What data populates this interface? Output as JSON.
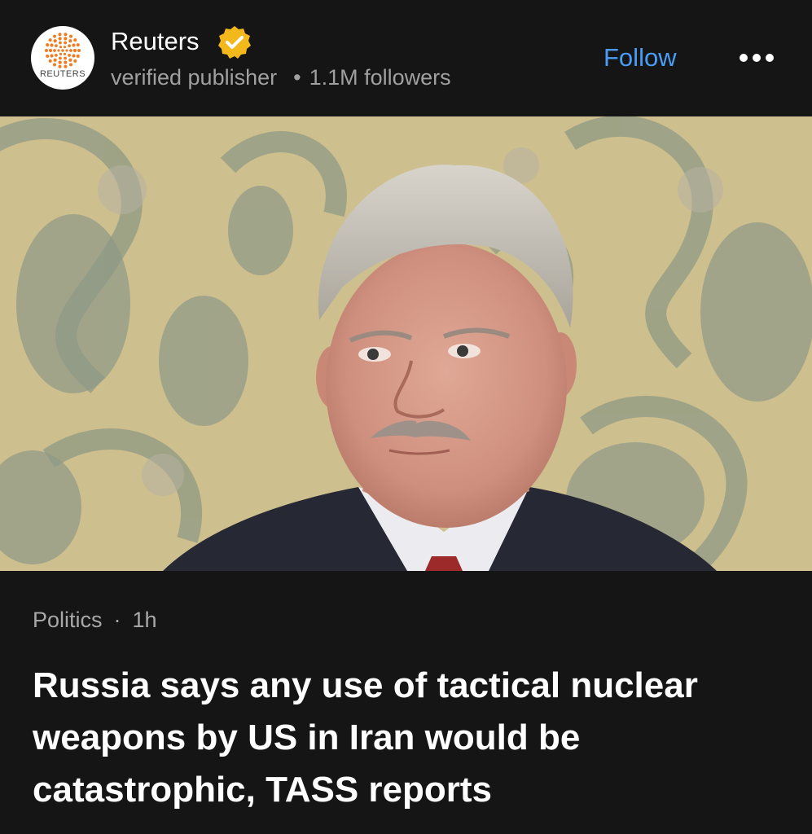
{
  "publisher": {
    "name": "Reuters",
    "logo_text": "REUTERS",
    "verified_icon": "verified-badge-icon",
    "subtitle": "verified publisher",
    "separator": "•",
    "followers": "1.1M followers"
  },
  "actions": {
    "follow_label": "Follow",
    "more_icon": "more-options-icon"
  },
  "article": {
    "category": "Politics",
    "separator": "·",
    "age": "1h",
    "headline": "Russia says any use of tactical nuclear weapons by US in Iran would be catastrophic, TASS reports"
  },
  "colors": {
    "background": "#151515",
    "accent": "#4a9cf5",
    "badge": "#f2b81c",
    "secondary_text": "#a0a0a0"
  }
}
